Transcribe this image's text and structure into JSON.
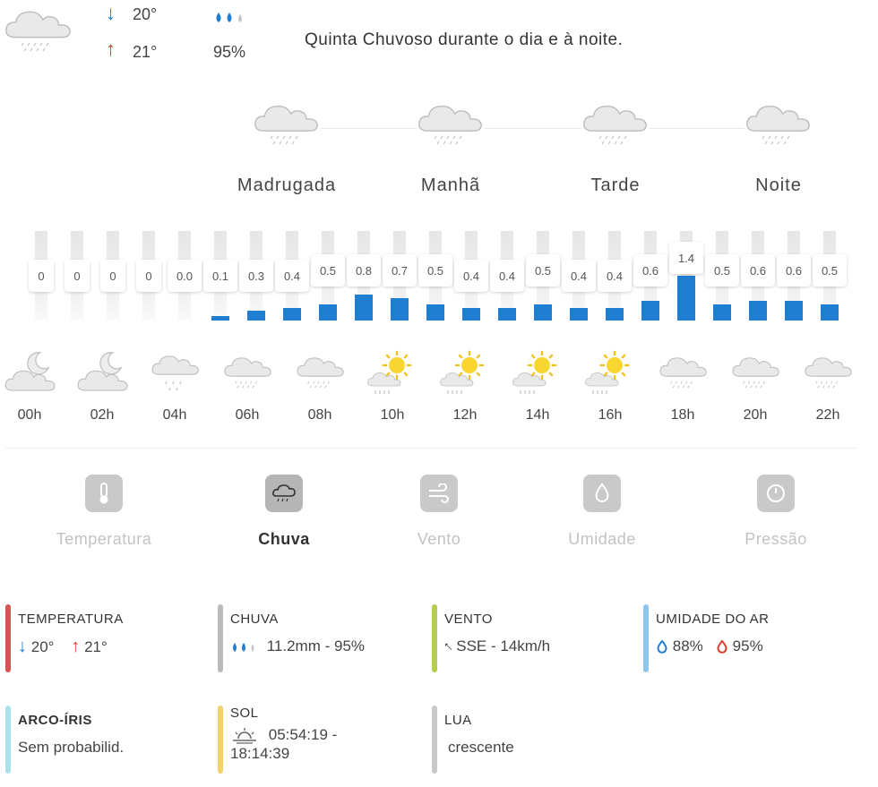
{
  "day_summary": {
    "min_temp": "20°",
    "max_temp": "21°",
    "rain_chance": "95%",
    "text": "Quinta Chuvoso durante o dia e à noite."
  },
  "periods": [
    {
      "label": "Madrugada",
      "icon": "rain-cloud-icon"
    },
    {
      "label": "Manhã",
      "icon": "rain-cloud-icon"
    },
    {
      "label": "Tarde",
      "icon": "rain-cloud-icon"
    },
    {
      "label": "Noite",
      "icon": "rain-cloud-icon"
    }
  ],
  "hourly_rain": [
    "0",
    "0",
    "0",
    "0",
    "0.0",
    "0.1",
    "0.3",
    "0.4",
    "0.5",
    "0.8",
    "0.7",
    "0.5",
    "0.4",
    "0.4",
    "0.5",
    "0.4",
    "0.4",
    "0.6",
    "1.4",
    "0.5",
    "0.6",
    "0.6",
    "0.5"
  ],
  "hourly": [
    {
      "time": "00h",
      "icon": "moon-cloud-icon"
    },
    {
      "time": "02h",
      "icon": "moon-cloud-icon"
    },
    {
      "time": "04h",
      "icon": "light-rain-icon"
    },
    {
      "time": "06h",
      "icon": "rain-cloud-icon"
    },
    {
      "time": "08h",
      "icon": "rain-cloud-icon"
    },
    {
      "time": "10h",
      "icon": "sun-rain-icon"
    },
    {
      "time": "12h",
      "icon": "sun-rain-icon"
    },
    {
      "time": "14h",
      "icon": "sun-rain-icon"
    },
    {
      "time": "16h",
      "icon": "sun-rain-icon"
    },
    {
      "time": "18h",
      "icon": "rain-cloud-icon"
    },
    {
      "time": "20h",
      "icon": "rain-cloud-icon"
    },
    {
      "time": "22h",
      "icon": "rain-cloud-icon"
    }
  ],
  "tabs": {
    "temperatura": "Temperatura",
    "chuva": "Chuva",
    "vento": "Vento",
    "umidade": "Umidade",
    "pressao": "Pressão"
  },
  "details": {
    "temperatura": {
      "title": "TEMPERATURA",
      "min": "20°",
      "max": "21°"
    },
    "chuva": {
      "title": "CHUVA",
      "value": "11.2mm - 95%"
    },
    "vento": {
      "title": "VENTO",
      "value": "SSE - 14km/h"
    },
    "umidade": {
      "title": "UMIDADE DO AR",
      "min": "88%",
      "max": "95%"
    },
    "arco_iris": {
      "title": "ARCO-ÍRIS",
      "value": "Sem probabilid."
    },
    "sol": {
      "title": "SOL",
      "value_line1": "05:54:19 -",
      "value_line2": "18:14:39"
    },
    "lua": {
      "title": "LUA",
      "value": "crescente"
    }
  },
  "colors": {
    "bar": "#1f7dd2",
    "temperatura_accent": "#d9534f",
    "chuva_accent": "#bbbbbb",
    "vento_accent": "#b5cf4b",
    "umidade_accent": "#8cc6ee",
    "arco_iris_accent": "#a8e3ec",
    "sol_accent": "#f4d26b",
    "lua_accent": "#c8c8c8"
  }
}
